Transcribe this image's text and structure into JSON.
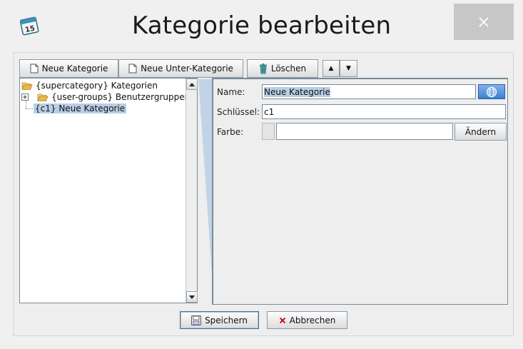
{
  "window": {
    "title": "Kategorie bearbeiten",
    "app_icon_text": "15",
    "close_symbol": "✕"
  },
  "toolbar": {
    "new_category": "Neue Kategorie",
    "new_sub_category": "Neue Unter-Kategorie",
    "delete": "Löschen",
    "move_up": "▲",
    "move_down": "▼"
  },
  "tree": {
    "items": [
      {
        "label": "{supercategory} Kategorien",
        "expander": ""
      },
      {
        "label": "{user-groups} Benutzergruppen",
        "expander": "+"
      },
      {
        "label": "{c1} Neue Kategorie",
        "selected": true
      }
    ]
  },
  "form": {
    "name_label": "Name:",
    "name_value": "Neue Kategorie",
    "key_label": "Schlüssel:",
    "key_value": "c1",
    "color_label": "Farbe:",
    "color_value": "",
    "change_button": "Ändern"
  },
  "footer": {
    "save": "Speichern",
    "cancel": "Abbrechen"
  },
  "colors": {
    "accent_selected": "#b8cfe5",
    "close_bg": "#c7c7c7",
    "folder": "#e8b84a",
    "cancel_x": "#cc0000"
  }
}
